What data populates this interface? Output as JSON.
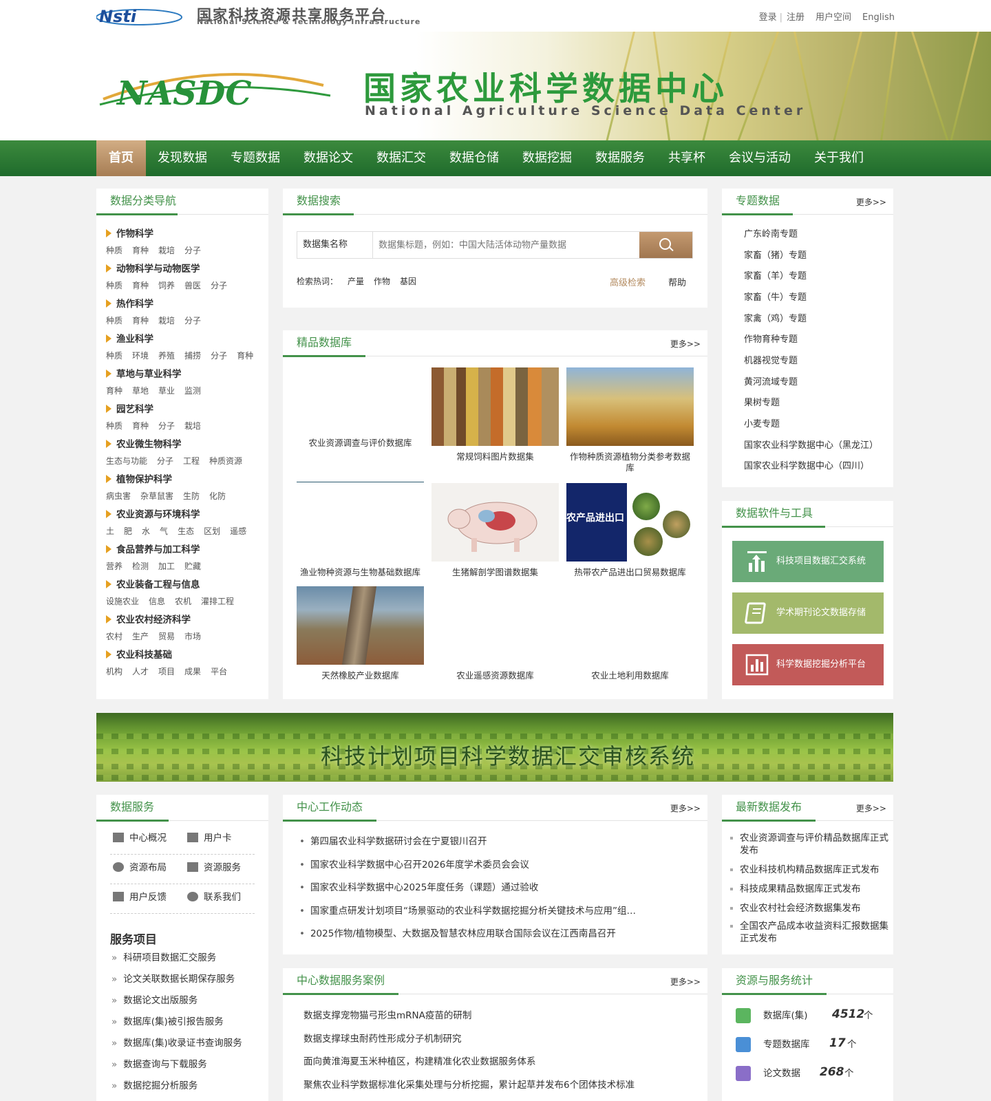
{
  "header": {
    "platform_cn": "国家科技资源共享服务平台",
    "platform_en": "National Science & Technology Infrastructure",
    "logo_text": "Nsti",
    "links": {
      "login": "登录",
      "register": "注册",
      "user_space": "用户空间",
      "english": "English"
    },
    "center_logo": "NASDC",
    "center_cn": "国家农业科学数据中心",
    "center_en": "National Agriculture Science Data Center"
  },
  "nav": [
    "首页",
    "发现数据",
    "专题数据",
    "数据论文",
    "数据汇交",
    "数据仓储",
    "数据挖掘",
    "数据服务",
    "共享杯",
    "会议与活动",
    "关于我们"
  ],
  "category_nav": {
    "title": "数据分类导航",
    "categories": [
      {
        "name": "作物科学",
        "subs": [
          "种质",
          "育种",
          "栽培",
          "分子"
        ]
      },
      {
        "name": "动物科学与动物医学",
        "subs": [
          "种质",
          "育种",
          "饲养",
          "兽医",
          "分子"
        ]
      },
      {
        "name": "热作科学",
        "subs": [
          "种质",
          "育种",
          "栽培",
          "分子"
        ]
      },
      {
        "name": "渔业科学",
        "subs": [
          "种质",
          "环境",
          "养殖",
          "捕捞",
          "分子",
          "育种"
        ]
      },
      {
        "name": "草地与草业科学",
        "subs": [
          "育种",
          "草地",
          "草业",
          "监测"
        ]
      },
      {
        "name": "园艺科学",
        "subs": [
          "种质",
          "育种",
          "分子",
          "栽培"
        ]
      },
      {
        "name": "农业微生物科学",
        "subs": [
          "生态与功能",
          "分子",
          "工程",
          "种质资源"
        ]
      },
      {
        "name": "植物保护科学",
        "subs": [
          "病虫害",
          "杂草鼠害",
          "生防",
          "化防"
        ]
      },
      {
        "name": "农业资源与环境科学",
        "subs": [
          "土",
          "肥",
          "水",
          "气",
          "生态",
          "区划",
          "遥感"
        ]
      },
      {
        "name": "食品营养与加工科学",
        "subs": [
          "营养",
          "检测",
          "加工",
          "贮藏"
        ]
      },
      {
        "name": "农业装备工程与信息",
        "subs": [
          "设施农业",
          "信息",
          "农机",
          "灌排工程"
        ]
      },
      {
        "name": "农业农村经济科学",
        "subs": [
          "农村",
          "生产",
          "贸易",
          "市场"
        ]
      },
      {
        "name": "农业科技基础",
        "subs": [
          "机构",
          "人才",
          "项目",
          "成果",
          "平台"
        ]
      }
    ]
  },
  "search": {
    "title": "数据搜索",
    "type": "数据集名称",
    "placeholder": "数据集标题，例如：中国大陆活体动物产量数据",
    "hot_label": "检索热词：",
    "hot_words": [
      "产量",
      "作物",
      "基因"
    ],
    "advanced": "高级检索",
    "help": "帮助"
  },
  "featured": {
    "title": "精品数据库",
    "more": "更多>>",
    "items": [
      "农业资源调查与评价数据库",
      "常规饲料图片数据集",
      "作物种质资源植物分类参考数据库",
      "渔业物种资源与生物基础数据库",
      "生猪解剖学图谱数据集",
      "热带农产品进出口贸易数据库",
      "天然橡胶产业数据库",
      "农业遥感资源数据库",
      "农业土地利用数据库"
    ],
    "trade_img_text": "农产品进出口"
  },
  "topics": {
    "title": "专题数据",
    "more": "更多>>",
    "items": [
      "广东岭南专题",
      "家畜（猪）专题",
      "家畜（羊）专题",
      "家畜（牛）专题",
      "家禽（鸡）专题",
      "作物育种专题",
      "机器视觉专题",
      "黄河流域专题",
      "果树专题",
      "小麦专题",
      "国家农业科学数据中心（黑龙江）",
      "国家农业科学数据中心（四川）"
    ]
  },
  "tools": {
    "title": "数据软件与工具",
    "items": [
      {
        "label": "科技项目数据汇交系统",
        "color": "#6aaa78"
      },
      {
        "label": "学术期刊论文数据存储",
        "color": "#a3b96b"
      },
      {
        "label": "科学数据挖掘分析平台",
        "color": "#c25a59"
      }
    ]
  },
  "promo": {
    "text": "科技计划项目科学数据汇交审核系统"
  },
  "data_services": {
    "title": "数据服务",
    "links": [
      "中心概况",
      "用户卡",
      "资源布局",
      "资源服务",
      "用户反馈",
      "联系我们"
    ],
    "projects_title": "服务项目",
    "projects": [
      "科研项目数据汇交服务",
      "论文关联数据长期保存服务",
      "数据论文出版服务",
      "数据库(集)被引报告服务",
      "数据库(集)收录证书查询服务",
      "数据查询与下载服务",
      "数据挖掘分析服务"
    ]
  },
  "news": {
    "title": "中心工作动态",
    "more": "更多>>",
    "items": [
      "第四届农业科学数据研讨会在宁夏银川召开",
      "国家农业科学数据中心召开2026年度学术委员会会议",
      "国家农业科学数据中心2025年度任务（课题）通过验收",
      "国家重点研发计划项目“场景驱动的农业科学数据挖掘分析关键技术与应用”组织召开年度工作会议",
      "2025作物/植物模型、大数据及智慧农林应用联合国际会议在江西南昌召开"
    ]
  },
  "cases": {
    "title": "中心数据服务案例",
    "more": "更多>>",
    "items": [
      "数据支撑宠物猫弓形虫mRNA疫苗的研制",
      "数据支撑球虫耐药性形成分子机制研究",
      "面向黄淮海夏玉米种植区，构建精准化农业数据服务体系",
      "聚焦农业科学数据标准化采集处理与分析挖掘，累计起草并发布6个团体技术标准"
    ]
  },
  "releases": {
    "title": "最新数据发布",
    "more": "更多>>",
    "items": [
      "农业资源调查与评价精品数据库正式发布",
      "农业科技机构精品数据库正式发布",
      "科技成果精品数据库正式发布",
      "农业农村社会经济数据集发布",
      "全国农产品成本收益资料汇报数据集正式发布"
    ]
  },
  "stats": {
    "title": "资源与服务统计",
    "items": [
      {
        "label": "数据库(集)",
        "value": "4512",
        "unit": "个",
        "color": "#5bb55f"
      },
      {
        "label": "专题数据库",
        "value": "17",
        "unit": "个",
        "color": "#4a8fd6"
      },
      {
        "label": "论文数据",
        "value": "268",
        "unit": "个",
        "color": "#8a6ec8"
      }
    ]
  }
}
